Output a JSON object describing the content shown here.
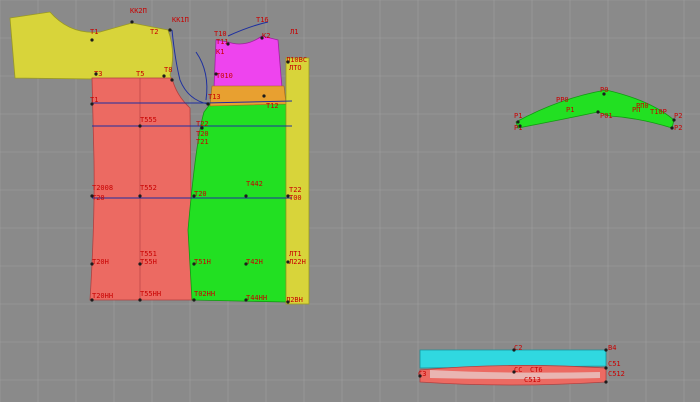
{
  "colors": {
    "background": "#8a8a8a",
    "grid": "#9e9e9e",
    "yellow": "#d8d43a",
    "red": "#ec6a62",
    "green": "#22e022",
    "magenta": "#ee44ee",
    "orange": "#e8a030",
    "cyan": "#30d8e0",
    "guide": "#1d2fa0",
    "label": "#c80000"
  },
  "shoulder_piece": {
    "labels": [
      "КК2П",
      "КК1П",
      "Т1",
      "Т2",
      "Т5",
      "Т8",
      "Т3"
    ]
  },
  "front_piece": {
    "labels": [
      "Т1",
      "Т55",
      "Т22",
      "Т555",
      "Т2008",
      "Т552",
      "Т20",
      "Т551",
      "Т55Н",
      "Т20Н",
      "Т20НН",
      "Т55НН"
    ]
  },
  "back_piece": {
    "labels": [
      "Т16",
      "К2",
      "К1",
      "Т10",
      "Т11",
      "Т010",
      "Т9",
      "Т13",
      "Т12",
      "Т22",
      "Т20",
      "Т21",
      "Т442",
      "Т20",
      "Т22",
      "Т00",
      "Т51Н",
      "Т42Н",
      "Т02НН",
      "Т44НН"
    ]
  },
  "strip_piece": {
    "labels": [
      "Л1",
      "ЛТО",
      "Т22",
      "ЛТ1",
      "Л22Н",
      "Л2ВН",
      "Л1",
      "Л10ВС"
    ]
  },
  "sleeve_piece": {
    "labels": [
      "Р1",
      "Р1",
      "РР0",
      "Р0",
      "РП0",
      "Р2",
      "Р2",
      "Р01",
      "Т10Р",
      "РП",
      "Р1"
    ]
  },
  "belt_piece": {
    "labels": [
      "С2",
      "В4",
      "СС",
      "СТ6",
      "С51",
      "С512",
      "С513",
      "С3"
    ]
  }
}
